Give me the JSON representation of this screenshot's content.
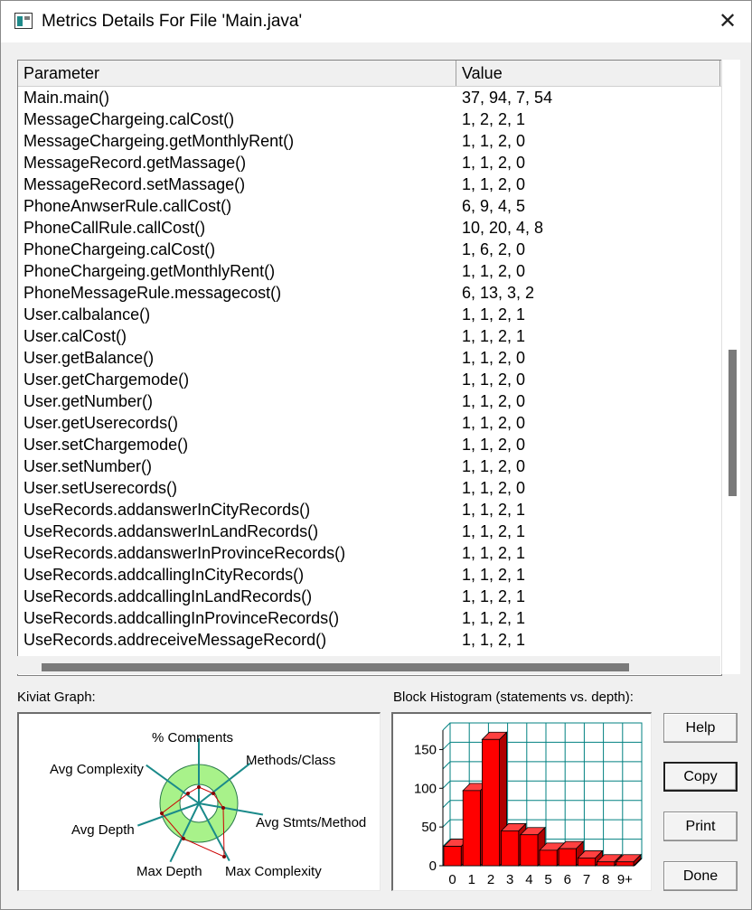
{
  "window": {
    "title": "Metrics Details For File 'Main.java'"
  },
  "table": {
    "headers": {
      "parameter": "Parameter",
      "value": "Value"
    },
    "rows": [
      {
        "parameter": "Main.main()",
        "value": "37, 94, 7, 54"
      },
      {
        "parameter": "MessageChargeing.calCost()",
        "value": "1, 2, 2, 1"
      },
      {
        "parameter": "MessageChargeing.getMonthlyRent()",
        "value": "1, 1, 2, 0"
      },
      {
        "parameter": "MessageRecord.getMassage()",
        "value": "1, 1, 2, 0"
      },
      {
        "parameter": "MessageRecord.setMassage()",
        "value": "1, 1, 2, 0"
      },
      {
        "parameter": "PhoneAnwserRule.callCost()",
        "value": "6, 9, 4, 5"
      },
      {
        "parameter": "PhoneCallRule.callCost()",
        "value": "10, 20, 4, 8"
      },
      {
        "parameter": "PhoneChargeing.calCost()",
        "value": "1, 6, 2, 0"
      },
      {
        "parameter": "PhoneChargeing.getMonthlyRent()",
        "value": "1, 1, 2, 0"
      },
      {
        "parameter": "PhoneMessageRule.messagecost()",
        "value": "6, 13, 3, 2"
      },
      {
        "parameter": "User.calbalance()",
        "value": "1, 1, 2, 1"
      },
      {
        "parameter": "User.calCost()",
        "value": "1, 1, 2, 1"
      },
      {
        "parameter": "User.getBalance()",
        "value": "1, 1, 2, 0"
      },
      {
        "parameter": "User.getChargemode()",
        "value": "1, 1, 2, 0"
      },
      {
        "parameter": "User.getNumber()",
        "value": "1, 1, 2, 0"
      },
      {
        "parameter": "User.getUserecords()",
        "value": "1, 1, 2, 0"
      },
      {
        "parameter": "User.setChargemode()",
        "value": "1, 1, 2, 0"
      },
      {
        "parameter": "User.setNumber()",
        "value": "1, 1, 2, 0"
      },
      {
        "parameter": "User.setUserecords()",
        "value": "1, 1, 2, 0"
      },
      {
        "parameter": "UseRecords.addanswerInCityRecords()",
        "value": "1, 1, 2, 1"
      },
      {
        "parameter": "UseRecords.addanswerInLandRecords()",
        "value": "1, 1, 2, 1"
      },
      {
        "parameter": "UseRecords.addanswerInProvinceRecords()",
        "value": "1, 1, 2, 1"
      },
      {
        "parameter": "UseRecords.addcallingInCityRecords()",
        "value": "1, 1, 2, 1"
      },
      {
        "parameter": "UseRecords.addcallingInLandRecords()",
        "value": "1, 1, 2, 1"
      },
      {
        "parameter": "UseRecords.addcallingInProvinceRecords()",
        "value": "1, 1, 2, 1"
      },
      {
        "parameter": "UseRecords.addreceiveMessageRecord()",
        "value": "1, 1, 2, 1"
      }
    ]
  },
  "kiviat": {
    "label": "Kiviat Graph:",
    "axes": [
      "% Comments",
      "Methods/Class",
      "Avg Stmts/Method",
      "Max Complexity",
      "Max Depth",
      "Avg Depth",
      "Avg Complexity"
    ]
  },
  "histogram": {
    "label": "Block Histogram (statements vs. depth):"
  },
  "chart_data": {
    "type": "bar",
    "categories": [
      "0",
      "1",
      "2",
      "3",
      "4",
      "5",
      "6",
      "7",
      "8",
      "9+"
    ],
    "values": [
      25,
      97,
      163,
      45,
      40,
      20,
      22,
      10,
      5,
      5
    ],
    "ylim": [
      0,
      175
    ],
    "yticks": [
      "0",
      "50",
      "100",
      "150"
    ],
    "bar_color": "#ff0000",
    "grid_color": "#008080"
  },
  "buttons": {
    "help": "Help",
    "copy": "Copy",
    "print": "Print",
    "done": "Done"
  },
  "icons": {
    "close": "close-icon",
    "app": "app-icon"
  }
}
